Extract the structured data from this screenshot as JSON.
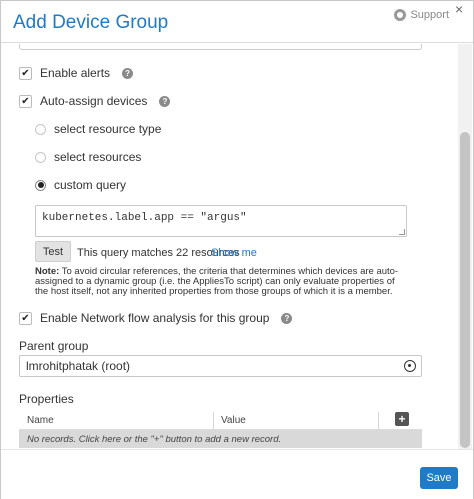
{
  "dialog": {
    "title": "Add Device Group",
    "support_label": "Support"
  },
  "options": {
    "enable_alerts": {
      "label": "Enable alerts",
      "checked": true
    },
    "auto_assign": {
      "label": "Auto-assign devices",
      "checked": true
    }
  },
  "assign_mode": {
    "options": [
      {
        "label": "select resource type",
        "selected": false
      },
      {
        "label": "select resources",
        "selected": false
      },
      {
        "label": "custom query",
        "selected": true
      }
    ]
  },
  "query": {
    "value": "kubernetes.label.app == \"argus\"",
    "test_label": "Test",
    "result_text": "This query matches 22 resources",
    "show_me_label": "Show me"
  },
  "note": {
    "prefix": "Note:",
    "text": " To avoid circular references, the criteria that determines which devices are auto-assigned to a dynamic group (i.e. the AppliesTo script) can only evaluate properties of the host itself, not any inherited properties from those groups of which it is a member."
  },
  "netflow": {
    "label": "Enable Network flow analysis for this group",
    "checked": true
  },
  "parent_group": {
    "label": "Parent group",
    "value": "lmrohitphatak (root)"
  },
  "properties": {
    "label": "Properties",
    "columns": [
      "Name",
      "Value"
    ],
    "add_label": "+",
    "empty_text": "No records. Click here or the \"+\" button to add a new record."
  },
  "footer": {
    "save_label": "Save"
  },
  "colors": {
    "accent": "#1f7ac7",
    "empty_row": "#d9d9d9"
  }
}
